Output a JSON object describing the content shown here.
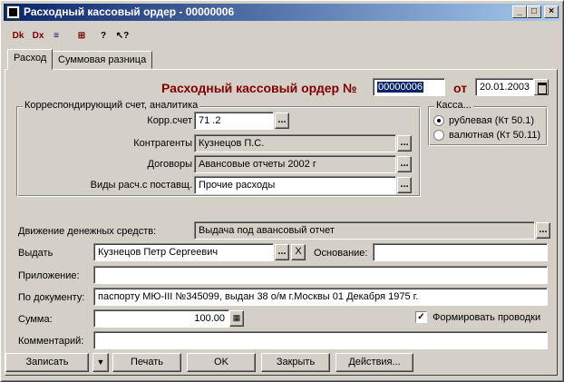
{
  "window": {
    "title": "Расходный кассовый ордер - 00000006"
  },
  "captions": {
    "minimize": "_",
    "maximize": "□",
    "close": "×"
  },
  "toolbar": {
    "icons": [
      {
        "name": "doc-delete-icon",
        "glyph": "Dk"
      },
      {
        "name": "doc-cancel-icon",
        "glyph": "Dx"
      },
      {
        "name": "doc-post-icon",
        "glyph": "≡"
      },
      {
        "name": "doc-table-icon",
        "glyph": "⊞"
      },
      {
        "name": "help-icon",
        "glyph": "?"
      },
      {
        "name": "context-help-icon",
        "glyph": "↖?"
      }
    ]
  },
  "tabs": [
    "Расход",
    "Суммовая разница"
  ],
  "header": {
    "title": "Расходный кассовый ордер №",
    "number": "00000006",
    "from_label": "от",
    "date": "20.01.2003"
  },
  "corr_group": {
    "legend": "Корреспондирующий счет, аналитика",
    "account_label": "Корр.счет",
    "account_value": "71 .2",
    "contractor_label": "Контрагенты",
    "contractor_value": "Кузнецов П.С.",
    "contract_label": "Договоры",
    "contract_value": "Авансовые отчеты 2002 г",
    "settlement_label": "Виды расч.с поставщ.",
    "settlement_value": "Прочие расходы"
  },
  "kassa": {
    "legend": "Касса...",
    "options": [
      "рублевая (Кт 50.1)",
      "валютная (Кт 50.11)"
    ],
    "selected": 0
  },
  "form": {
    "cash_flow_label": "Движение денежных средств:",
    "cash_flow_value": "Выдача под авансовый отчет",
    "issue_label": "Выдать",
    "issue_value": "Кузнецов Петр Сергеевич",
    "basis_label": "Основание:",
    "basis_value": "",
    "attachment_label": "Приложение:",
    "attachment_value": "",
    "document_label": "По документу:",
    "document_value": "паспорту МЮ-III №345099, выдан 38 о/м г.Москвы 01 Декабря 1975 г.",
    "sum_label": "Сумма:",
    "sum_value": "100.00",
    "postings_label": "Формировать проводки",
    "postings_checked": true,
    "comment_label": "Комментарий:",
    "comment_value": ""
  },
  "buttons": {
    "save": "Записать",
    "save_menu": "▼",
    "print": "Печать",
    "ok": "OK",
    "close": "Закрыть",
    "actions": "Действия...",
    "dots": "...",
    "clear": "X"
  }
}
